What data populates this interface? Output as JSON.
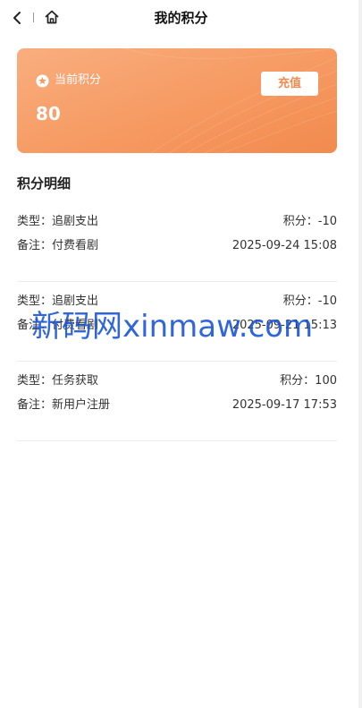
{
  "header": {
    "title": "我的积分"
  },
  "points_card": {
    "label": "当前积分",
    "value": "80",
    "recharge_label": "充值",
    "colors": {
      "gradient_start": "#f9ae7f",
      "gradient_end": "#f28a4d",
      "button_text": "#f08a4d"
    }
  },
  "details": {
    "title": "积分明细",
    "records": [
      {
        "type_label": "类型：",
        "type_value": "追剧支出",
        "points_label": "积分：",
        "points_value": "-10",
        "note_label": "备注：",
        "note_value": "付费看剧",
        "time": "2025-09-24 15:08"
      },
      {
        "type_label": "类型：",
        "type_value": "追剧支出",
        "points_label": "积分：",
        "points_value": "-10",
        "note_label": "备注：",
        "note_value": "付费看剧",
        "time": "2025-09-21 15:13"
      },
      {
        "type_label": "类型：",
        "type_value": "任务获取",
        "points_label": "积分：",
        "points_value": "100",
        "note_label": "备注：",
        "note_value": "新用户注册",
        "time": "2025-09-17 17:53"
      }
    ]
  },
  "watermark": {
    "text": "新码网xinmaw.com",
    "color": "#1a56d8"
  },
  "icons": {
    "back": "chevron-left-icon",
    "home": "home-icon",
    "star": "star-circle-icon"
  }
}
